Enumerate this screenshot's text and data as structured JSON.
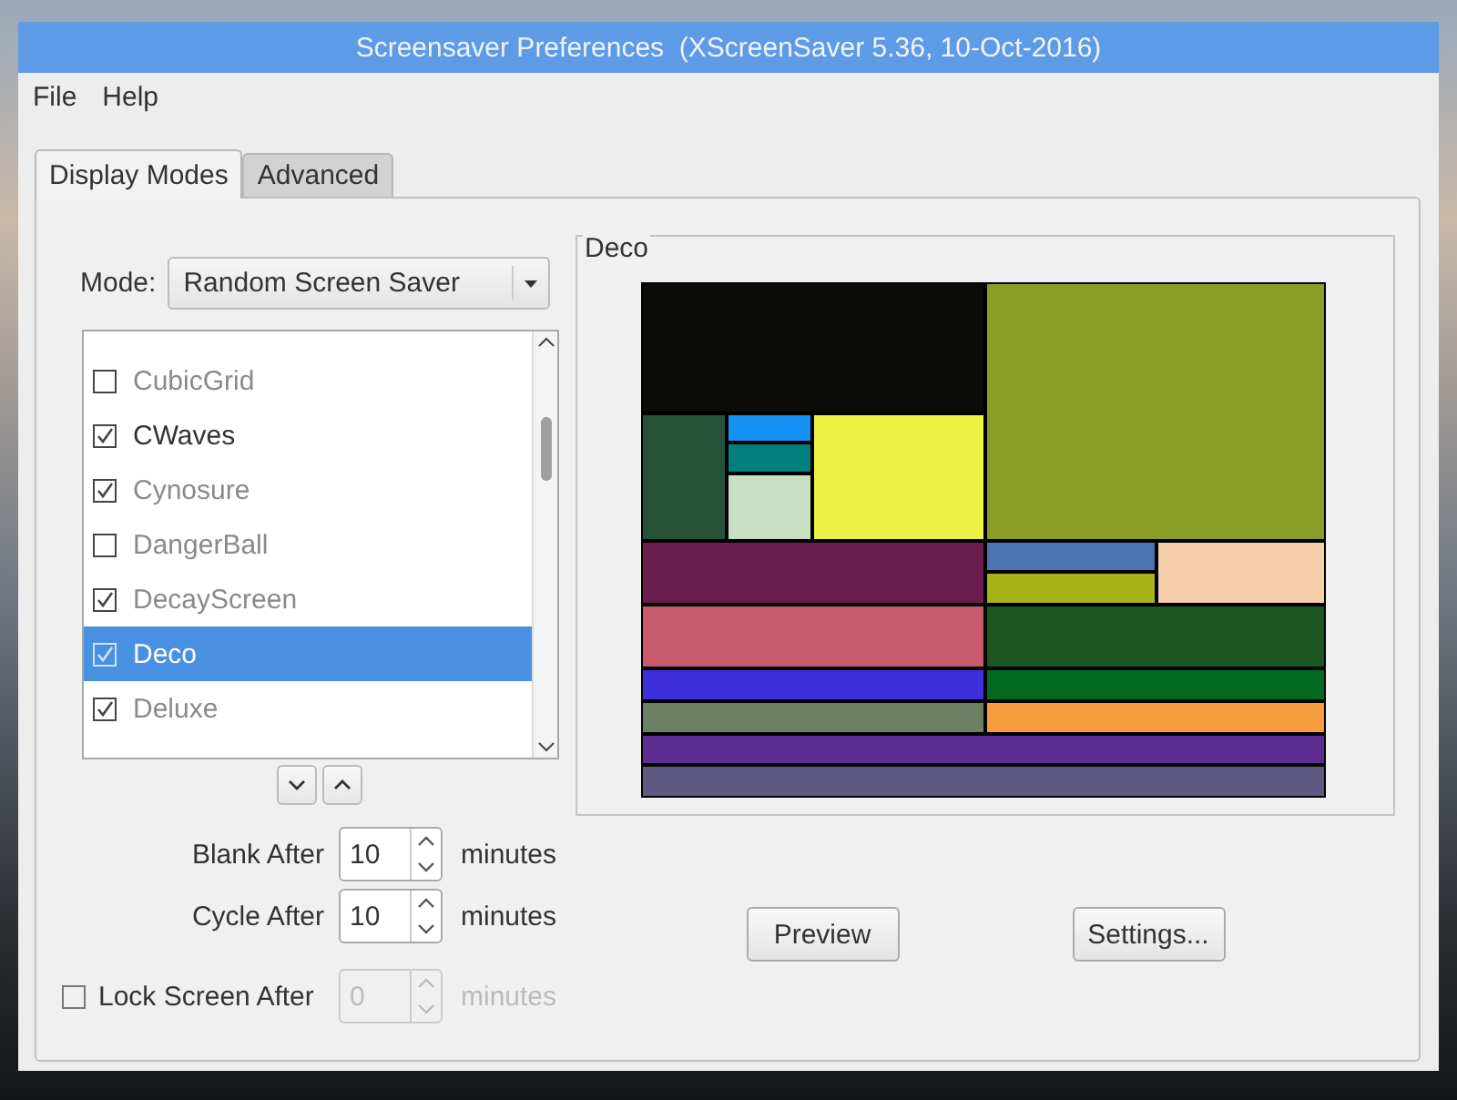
{
  "window": {
    "title": "Screensaver Preferences  (XScreenSaver 5.36, 10-Oct-2016)"
  },
  "menu": [
    "File",
    "Help"
  ],
  "tabs": [
    {
      "label": "Display Modes",
      "selected": true
    },
    {
      "label": "Advanced",
      "selected": false
    }
  ],
  "mode": {
    "label": "Mode:",
    "value": "Random Screen Saver"
  },
  "screensavers": [
    {
      "name": "CubicGrid",
      "checked": false,
      "selected": false,
      "dimmed": true
    },
    {
      "name": "CWaves",
      "checked": true,
      "selected": false,
      "dimmed": false
    },
    {
      "name": "Cynosure",
      "checked": true,
      "selected": false,
      "dimmed": true
    },
    {
      "name": "DangerBall",
      "checked": false,
      "selected": false,
      "dimmed": true
    },
    {
      "name": "DecayScreen",
      "checked": true,
      "selected": false,
      "dimmed": true
    },
    {
      "name": "Deco",
      "checked": true,
      "selected": true,
      "dimmed": true
    },
    {
      "name": "Deluxe",
      "checked": true,
      "selected": false,
      "dimmed": true
    }
  ],
  "timing": [
    {
      "kind": "spin",
      "label": "Blank After",
      "value": "10",
      "unit": "minutes",
      "disabled": false
    },
    {
      "kind": "spin",
      "label": "Cycle After",
      "value": "10",
      "unit": "minutes",
      "disabled": false
    },
    {
      "kind": "check",
      "label": "Lock Screen After",
      "checked": false,
      "value": "0",
      "unit": "minutes",
      "disabled": true
    }
  ],
  "preview": {
    "title": "Deco"
  },
  "buttons": [
    "Preview",
    "Settings..."
  ]
}
